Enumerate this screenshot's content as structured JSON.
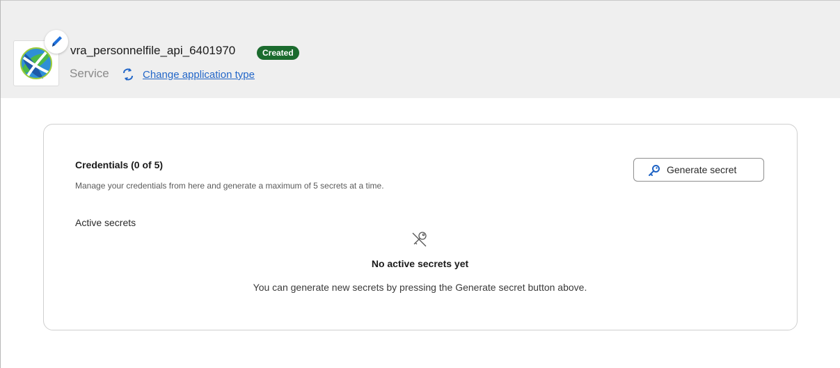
{
  "header": {
    "app_name": "vra_personnelfile_api_6401970",
    "status": "Created",
    "app_type": "Service",
    "change_type_link": "Change application type"
  },
  "icons": {
    "app_icon": "globe-logo-icon",
    "edit": "pencil-icon",
    "change_type": "swap-arrows-icon",
    "generate": "key-icon",
    "empty_state": "crossed-key-icon"
  },
  "colors": {
    "status_badge_bg": "#1b6b2e",
    "link": "#2266c8",
    "header_bg": "#efefef"
  },
  "credentials": {
    "title": "Credentials (0 of 5)",
    "description": "Manage your credentials from here and generate a maximum of 5 secrets at a time.",
    "generate_button": "Generate secret",
    "active_label": "Active secrets",
    "empty_title": "No active secrets yet",
    "empty_description": "You can generate new secrets by pressing the Generate secret button above."
  }
}
